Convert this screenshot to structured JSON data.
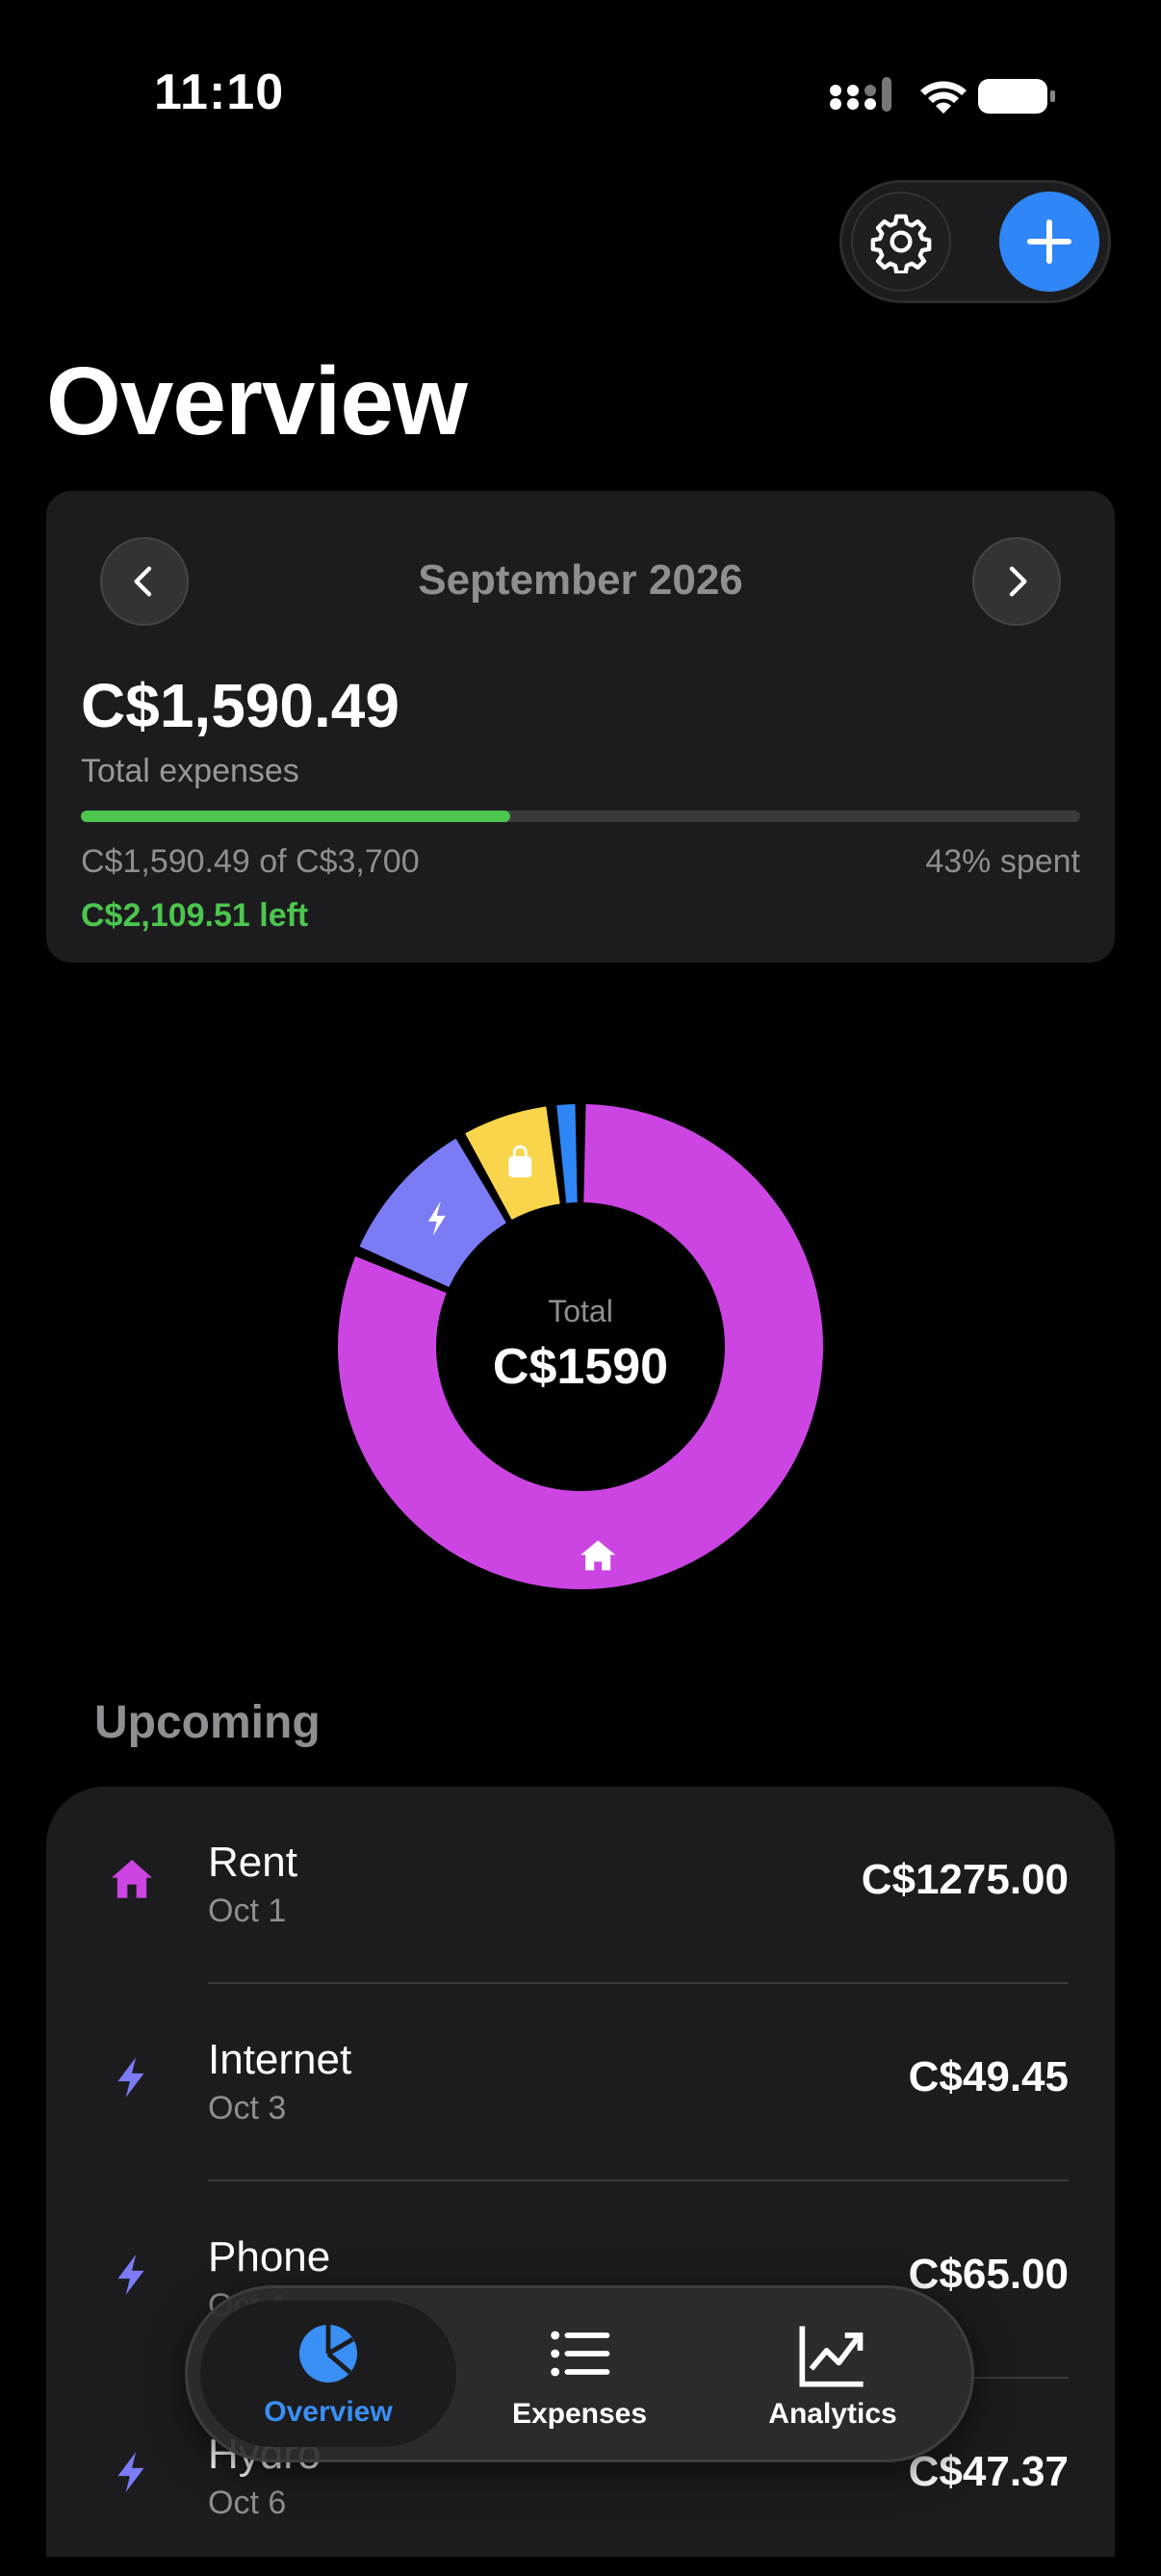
{
  "status_bar": {
    "time": "11:10"
  },
  "page": {
    "title": "Overview"
  },
  "month_card": {
    "month": "September 2026",
    "total_amount": "C$1,590.49",
    "total_label": "Total expenses",
    "budget_text": "C$1,590.49 of C$3,700",
    "spent_text": "43% spent",
    "left_text": "C$2,109.51 left",
    "progress_fraction": 0.43,
    "progress_color": "#4cc64e"
  },
  "donut": {
    "total_label": "Total",
    "total_value": "C$1590",
    "segments": [
      {
        "category": "home-icon",
        "value": 1275.0,
        "color": "#cc45e3"
      },
      {
        "category": "bolt-icon",
        "value": 161.82,
        "color": "#7b7cf5"
      },
      {
        "category": "bag-icon",
        "value": 99.0,
        "color": "#f8d54b"
      },
      {
        "category": "other",
        "value": 30.0,
        "color": "#2f86f6"
      }
    ]
  },
  "upcoming": {
    "title": "Upcoming",
    "items": [
      {
        "name": "Rent",
        "date": "Oct 1",
        "amount": "C$1275.00",
        "icon": "home-icon",
        "color": "#cc45e3"
      },
      {
        "name": "Internet",
        "date": "Oct 3",
        "amount": "C$49.45",
        "icon": "bolt-icon",
        "color": "#7b7cf5"
      },
      {
        "name": "Phone",
        "date": "Oct 4",
        "amount": "C$65.00",
        "icon": "bolt-icon",
        "color": "#7b7cf5"
      },
      {
        "name": "Hydro",
        "date": "Oct 6",
        "amount": "C$47.37",
        "icon": "bolt-icon",
        "color": "#7b7cf5"
      }
    ]
  },
  "tabbar": {
    "tabs": [
      {
        "label": "Overview",
        "icon": "pie-chart-icon",
        "active": true
      },
      {
        "label": "Expenses",
        "icon": "list-icon",
        "active": false
      },
      {
        "label": "Analytics",
        "icon": "chart-line-icon",
        "active": false
      }
    ],
    "accent": "#3a8ff5"
  }
}
